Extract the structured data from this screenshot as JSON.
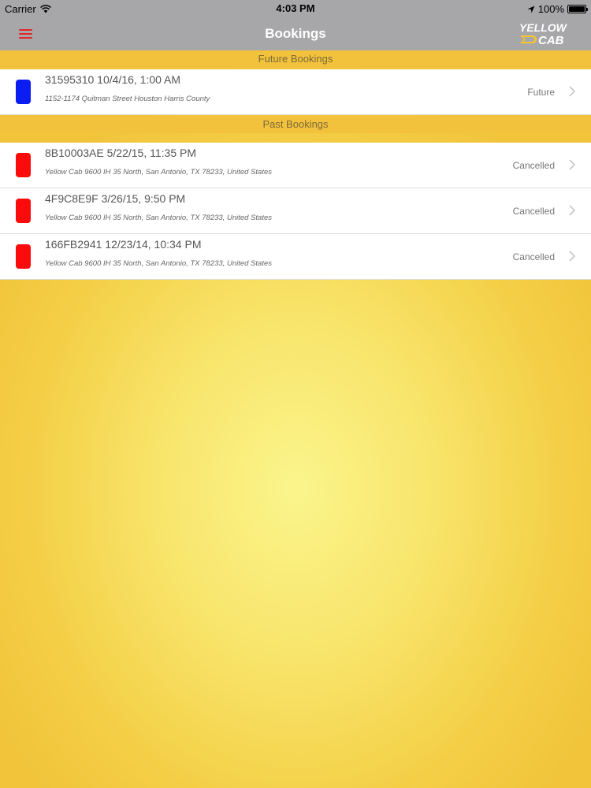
{
  "status_bar": {
    "carrier": "Carrier",
    "time": "4:03 PM",
    "battery": "100%"
  },
  "nav": {
    "title": "Bookings",
    "logo_text_top": "YELLOW",
    "logo_text_bottom": "CAB"
  },
  "sections": {
    "future_header": "Future Bookings",
    "past_header": "Past Bookings"
  },
  "future_bookings": [
    {
      "title": "31595310 10/4/16, 1:00 AM",
      "address": "1152-1174 Quitman Street Houston Harris County",
      "status": "Future",
      "marker_color": "#0a1df3"
    }
  ],
  "past_bookings": [
    {
      "title": "8B10003AE 5/22/15, 11:35 PM",
      "address": "Yellow Cab 9600 IH 35 North, San Antonio, TX 78233, United States",
      "status": "Cancelled",
      "marker_color": "#fb0b0b"
    },
    {
      "title": "4F9C8E9F 3/26/15, 9:50 PM",
      "address": "Yellow Cab 9600 IH 35 North, San Antonio, TX 78233, United States",
      "status": "Cancelled",
      "marker_color": "#fb0b0b"
    },
    {
      "title": "166FB2941 12/23/14, 10:34 PM",
      "address": "Yellow Cab 9600 IH 35 North, San Antonio, TX 78233, United States",
      "status": "Cancelled",
      "marker_color": "#fb0b0b"
    }
  ]
}
